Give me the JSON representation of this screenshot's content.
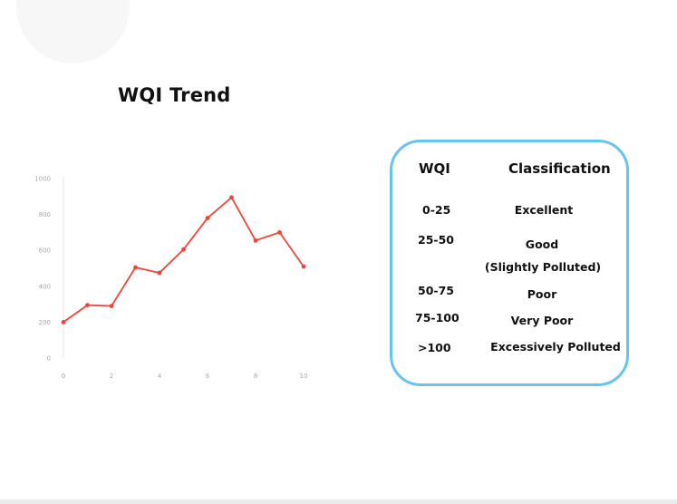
{
  "chart_data": {
    "type": "line",
    "title": "WQI Trend",
    "xlabel": "",
    "ylabel": "",
    "x": [
      0,
      1,
      2,
      3,
      4,
      5,
      6,
      7,
      8,
      9,
      10
    ],
    "series": [
      {
        "values": [
          200,
          295,
          290,
          505,
          475,
          605,
          780,
          895,
          655,
          700,
          510
        ]
      }
    ],
    "xlim": [
      0,
      10
    ],
    "ylim": [
      0,
      1000
    ],
    "xticks": [
      0,
      2,
      4,
      6,
      8,
      10
    ],
    "yticks": [
      0,
      200,
      400,
      600,
      800,
      1000
    ],
    "grid": false,
    "colors": {
      "line": "#ef4437",
      "axis": "#e6e6e6",
      "ticks": "#a8a8a8"
    }
  },
  "classification_table": {
    "headers": {
      "wqi": "WQI",
      "classification": "Classification"
    },
    "rows": [
      {
        "wqi": "0-25",
        "classification": "Excellent",
        "classification_line2": ""
      },
      {
        "wqi": "25-50",
        "classification": "Good",
        "classification_line2": "(Slightly Polluted)"
      },
      {
        "wqi": "50-75",
        "classification": "Poor",
        "classification_line2": ""
      },
      {
        "wqi": "75-100",
        "classification": "Very Poor",
        "classification_line2": ""
      },
      {
        "wqi": ">100",
        "classification": "Excessively Polluted",
        "classification_line2": ""
      }
    ],
    "border_color": "#64c5ee"
  }
}
